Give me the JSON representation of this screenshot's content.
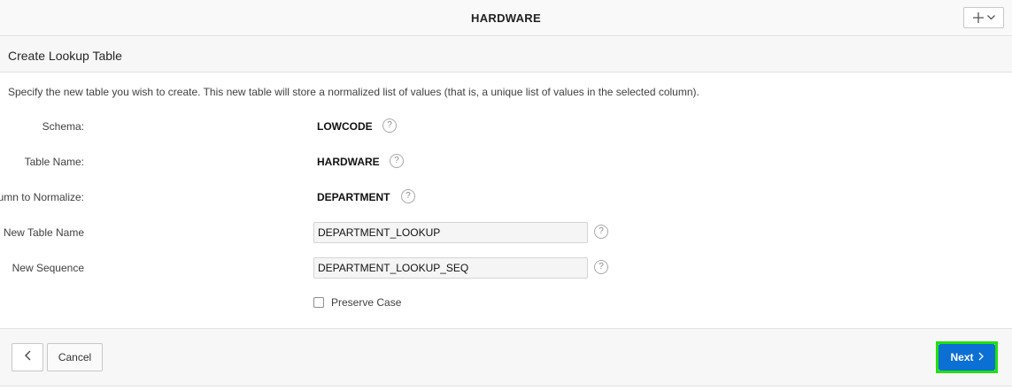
{
  "header": {
    "title": "HARDWARE",
    "add_menu_icons": [
      "plus-icon",
      "chevron-down-icon"
    ]
  },
  "region": {
    "title": "Create Lookup Table"
  },
  "instructions": "Specify the new table you wish to create. This new table will store a normalized list of values (that is, a unique list of values in the selected column).",
  "form": {
    "schema": {
      "label": "Schema:",
      "value": "LOWCODE"
    },
    "table_name": {
      "label": "Table Name:",
      "value": "HARDWARE"
    },
    "column_to_normalize": {
      "label": "Column to Normalize:",
      "value": "DEPARTMENT"
    },
    "new_table_name": {
      "label": "New Table Name",
      "value": "DEPARTMENT_LOOKUP"
    },
    "new_sequence": {
      "label": "New Sequence",
      "value": "DEPARTMENT_LOOKUP_SEQ"
    },
    "preserve_case": {
      "label": "Preserve Case",
      "checked": false
    },
    "help_icon": "?"
  },
  "footer": {
    "cancel_label": "Cancel",
    "next_label": "Next"
  },
  "colors": {
    "primary_button": "#0b6fd3",
    "highlight": "#22e00b"
  }
}
